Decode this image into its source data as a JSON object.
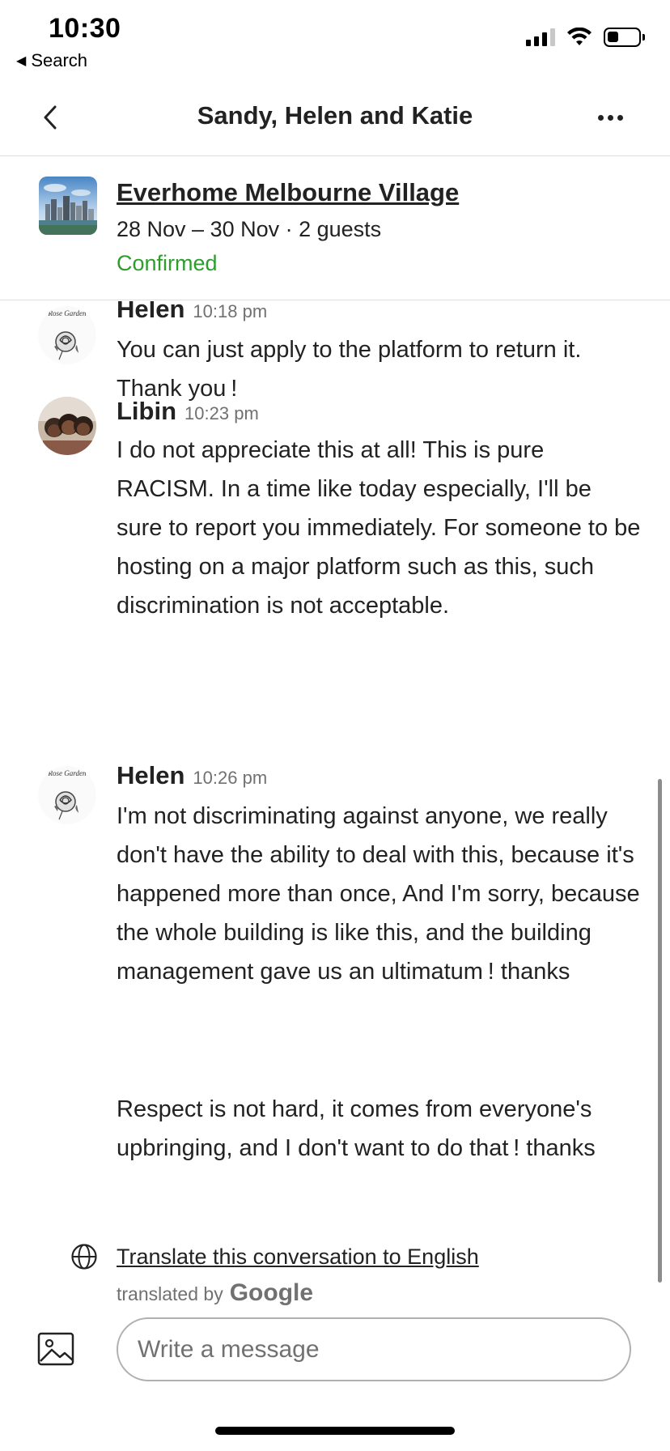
{
  "status_bar": {
    "time": "10:30",
    "back_label": "Search",
    "back_icon": "back-triangle-icon",
    "battery_level": 0.35,
    "signal_bars": 3
  },
  "header": {
    "title": "Sandy, Helen and Katie",
    "back_icon": "chevron-left-icon",
    "more_icon": "more-horizontal-icon"
  },
  "listing": {
    "name": "Everhome Melbourne Village",
    "dates": "28 Nov – 30 Nov · 2 guests",
    "status": "Confirmed",
    "status_color": "#2e9d2e",
    "thumbnail_icon": "city-skyline-thumbnail"
  },
  "messages": [
    {
      "sender": "Helen",
      "time": "10:18 pm",
      "avatar": "rose-garden-logo-avatar",
      "avatar_text": "Rose Garden",
      "paragraphs": [
        "You can just apply to the platform to return it. Thank you !"
      ]
    },
    {
      "sender": "Libin",
      "time": "10:23 pm",
      "avatar": "group-photo-avatar",
      "paragraphs": [
        "I do not appreciate this at all! This is pure RACISM. In a time like today especially, I'll be sure to report you immediately.  For someone to be hosting on a major platform such as this, such discrimination is not acceptable."
      ]
    },
    {
      "sender": "Helen",
      "time": "10:26 pm",
      "avatar": "rose-garden-logo-avatar",
      "avatar_text": "Rose Garden",
      "paragraphs": [
        "I'm not discriminating against anyone, we really don't have the ability to deal with this, because it's happened more than once, And I'm sorry, because the whole building is like this, and the building management gave us an ultimatum ! thanks",
        "Respect is not hard, it comes from everyone's upbringing, and I don't want to do that !   thanks"
      ]
    }
  ],
  "translate": {
    "link_label": "Translate this conversation to English",
    "translated_by": "translated by",
    "provider": "Google",
    "icon": "globe-icon"
  },
  "composer": {
    "placeholder": "Write a message",
    "image_icon": "image-icon"
  },
  "colors": {
    "text": "#222222",
    "secondary": "#717171",
    "divider": "#dddddd",
    "confirmed": "#2e9d2e"
  }
}
